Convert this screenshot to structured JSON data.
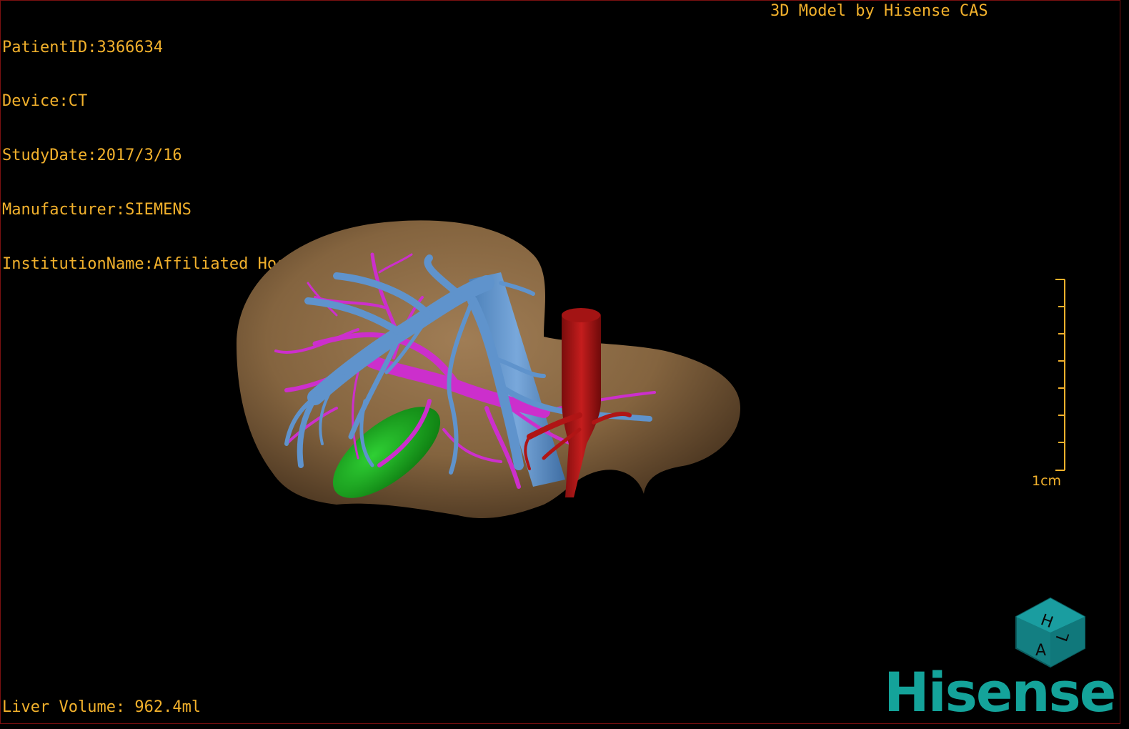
{
  "viewer": {
    "patient_id": "PatientID:3366634",
    "device": "Device:CT",
    "study_date": "StudyDate:2017/3/16",
    "manufacturer": "Manufacturer:SIEMENS",
    "institution": "InstitutionName:Affiliated Hospital Qingdao University-C",
    "model_credit": "3D Model by Hisense CAS",
    "liver_volume": "Liver Volume: 962.4ml",
    "scale_label": "1cm"
  },
  "orientation_cube": {
    "faces": [
      "H",
      "A",
      "L"
    ]
  },
  "logo": {
    "text": "Hisense"
  },
  "colors": {
    "overlay_text": "#f2b12c",
    "liver": "#8a6a45",
    "portal_vein": "#cc2fcc",
    "hepatic_vein": "#5f93cc",
    "artery_ivc": "#b01515",
    "gallbladder": "#18a81c",
    "brand": "#14a39a",
    "border": "#7a1010"
  },
  "icons": [
    "orientation-cube-icon"
  ]
}
